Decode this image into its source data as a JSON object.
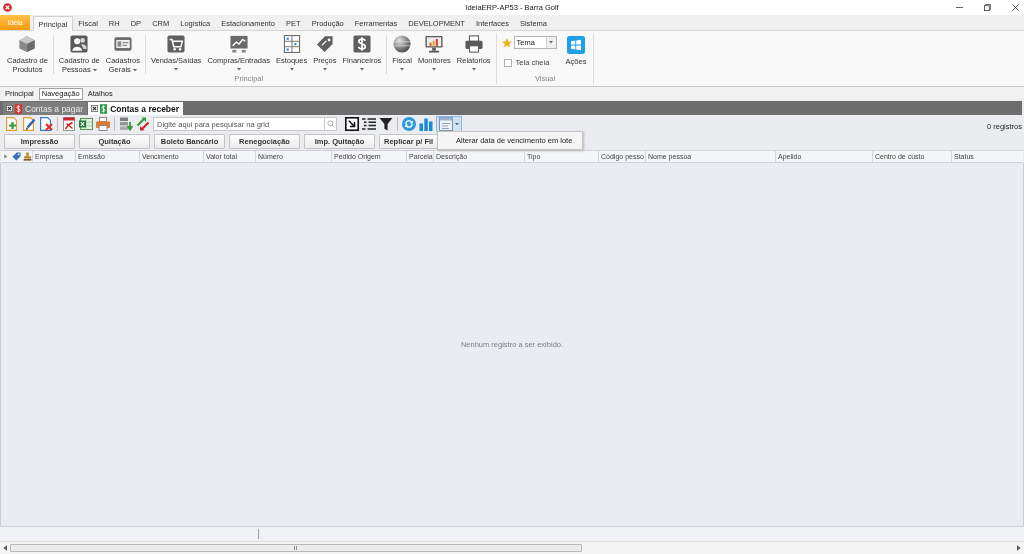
{
  "window": {
    "title": "IdeiaERP-AP53 - Barra Golf"
  },
  "ribbon_tabs": [
    {
      "label": "Ideia",
      "kind": "app",
      "selected": false
    },
    {
      "label": "Principal",
      "kind": "tab",
      "selected": true
    },
    {
      "label": "Fiscal",
      "kind": "tab",
      "selected": false
    },
    {
      "label": "RH",
      "kind": "tab",
      "selected": false
    },
    {
      "label": "DP",
      "kind": "tab",
      "selected": false
    },
    {
      "label": "CRM",
      "kind": "tab",
      "selected": false
    },
    {
      "label": "Logística",
      "kind": "tab",
      "selected": false
    },
    {
      "label": "Estacionamento",
      "kind": "tab",
      "selected": false
    },
    {
      "label": "PET",
      "kind": "tab",
      "selected": false
    },
    {
      "label": "Produção",
      "kind": "tab",
      "selected": false
    },
    {
      "label": "Ferramentas",
      "kind": "tab",
      "selected": false
    },
    {
      "label": "DEVELOPMENT",
      "kind": "tab",
      "selected": false
    },
    {
      "label": "Interfaces",
      "kind": "tab",
      "selected": false
    },
    {
      "label": "Sistema",
      "kind": "tab",
      "selected": false
    }
  ],
  "ribbon_groups": [
    {
      "kind": "buttons",
      "label": "Principal",
      "sections": [
        {
          "buttons": [
            {
              "label": "Cadastro de\nProdutos",
              "dropdown": false
            }
          ]
        },
        {
          "buttons": [
            {
              "label": "Cadastro de\nPessoas",
              "dropdown": true
            },
            {
              "label": "Cadastros\nGerais",
              "dropdown": true
            }
          ]
        },
        {
          "buttons": [
            {
              "label": "Vendas/Saídas",
              "dropdown": true
            },
            {
              "label": "Compras/Entradas",
              "dropdown": true
            },
            {
              "label": "Estoques",
              "dropdown": true
            },
            {
              "label": "Preços",
              "dropdown": true
            },
            {
              "label": "Financeiros",
              "dropdown": true
            }
          ]
        },
        {
          "buttons": [
            {
              "label": "Fiscal",
              "dropdown": true
            },
            {
              "label": "Monitores",
              "dropdown": true
            },
            {
              "label": "Relatorios",
              "dropdown": true
            }
          ]
        }
      ]
    },
    {
      "kind": "visual",
      "label": "Visual",
      "theme_select": {
        "value": "Tema"
      },
      "fullscreen": {
        "label": "Tela cheia",
        "checked": false
      },
      "action_button": {
        "label": "Ações"
      }
    }
  ],
  "view_tabs": [
    {
      "label": "Principal",
      "selected": false
    },
    {
      "label": "Navegação",
      "selected": true
    },
    {
      "label": "Atalhos",
      "selected": false
    }
  ],
  "document_tabs": [
    {
      "label": "Contas a pagar",
      "selected": false,
      "color": "#d9342b"
    },
    {
      "label": "Contas a receber",
      "selected": true,
      "color": "#2e9b4a"
    }
  ],
  "toolbar": {
    "search": {
      "placeholder": "Digite aqui para pesquisar na grid"
    },
    "menu_button": {
      "expanded": true,
      "menu": [
        "Alterar data de vencimento em lote"
      ]
    },
    "record_count": "0 registros"
  },
  "action_buttons": [
    "Impressão",
    "Quitação",
    "Boleto Bancário",
    "Renegociação",
    "Imp. Quitação",
    "Replicar p/ Fil"
  ],
  "grid": {
    "columns": [
      "Empresa",
      "Emissão",
      "Vencimento",
      "Valor total",
      "Número",
      "Pedido Origem",
      "Parcela",
      "Descrição",
      "Tipo",
      "Código pesso",
      "Nome pessoa",
      "Apelido",
      "Centro de custo",
      "Status"
    ],
    "empty_message": "Nenhum registro a ser exibido."
  }
}
